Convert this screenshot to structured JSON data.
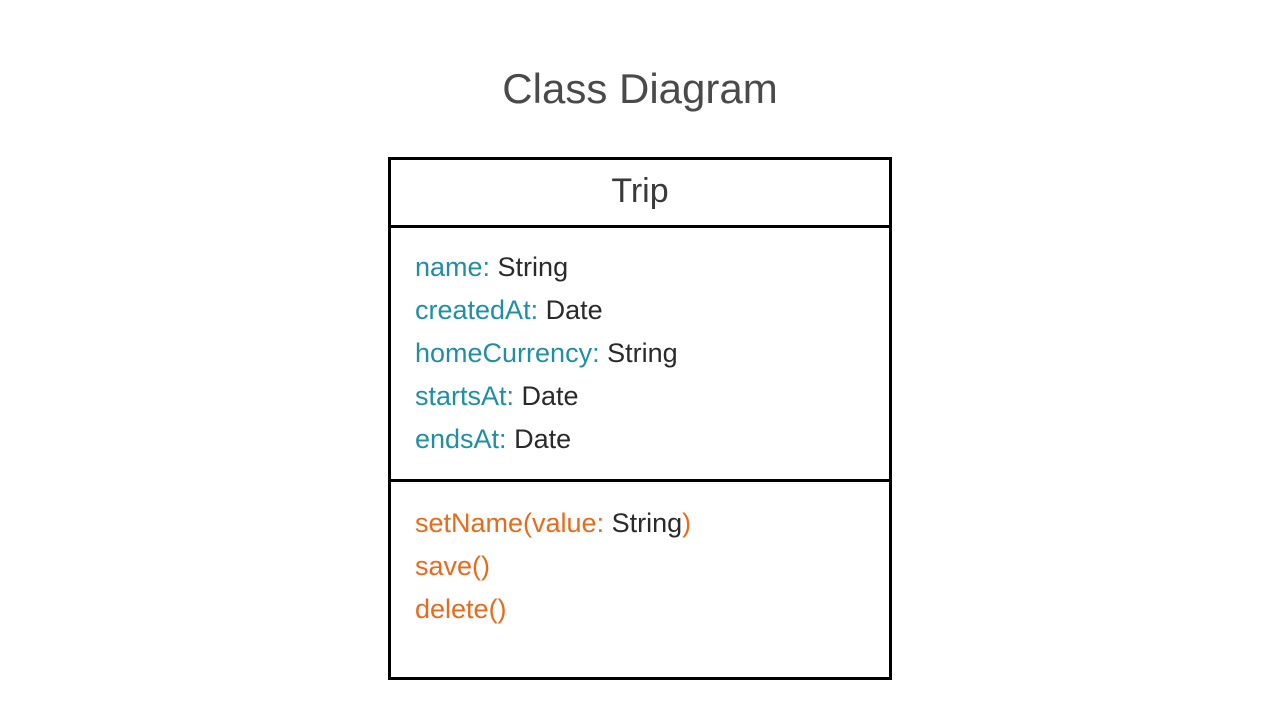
{
  "title": "Class Diagram",
  "class": {
    "name": "Trip",
    "attributes": [
      {
        "name": "name:",
        "type": " String"
      },
      {
        "name": "createdAt:",
        "type": " Date"
      },
      {
        "name": "homeCurrency:",
        "type": " String"
      },
      {
        "name": "startsAt:",
        "type": " Date"
      },
      {
        "name": "endsAt:",
        "type": " Date"
      }
    ],
    "methods": [
      {
        "pre": "setName(value:",
        "paramType": " String",
        "post": ")"
      },
      {
        "pre": "save()",
        "paramType": "",
        "post": ""
      },
      {
        "pre": "delete()",
        "paramType": "",
        "post": ""
      }
    ]
  },
  "colors": {
    "attributeName": "#1f8fa6",
    "method": "#e86a1a",
    "text": "#2a2a2a"
  }
}
